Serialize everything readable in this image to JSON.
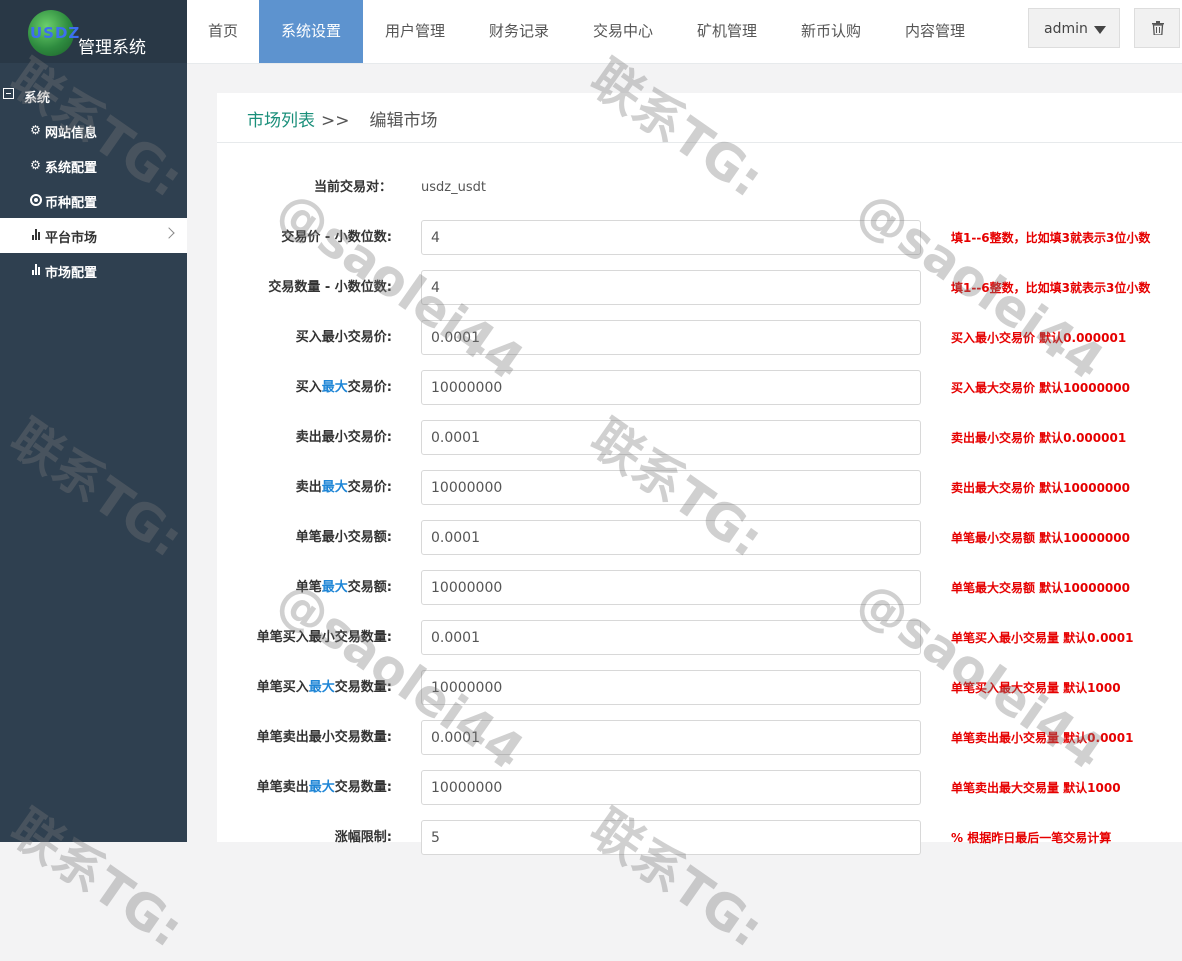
{
  "brand": {
    "logo_text": "USDZ",
    "title": "管理系统"
  },
  "sidebar": {
    "group_label": "系统",
    "items": [
      {
        "label": "网站信息",
        "icon": "gear-icon"
      },
      {
        "label": "系统配置",
        "icon": "gear-icon"
      },
      {
        "label": "币种配置",
        "icon": "target-icon"
      },
      {
        "label": "平台市场",
        "icon": "bar-chart-icon",
        "active": true
      },
      {
        "label": "市场配置",
        "icon": "bar-chart-icon"
      }
    ]
  },
  "topnav": {
    "tabs": [
      {
        "label": "首页"
      },
      {
        "label": "系统设置",
        "active": true
      },
      {
        "label": "用户管理"
      },
      {
        "label": "财务记录"
      },
      {
        "label": "交易中心"
      },
      {
        "label": "矿机管理"
      },
      {
        "label": "新币认购"
      },
      {
        "label": "内容管理"
      }
    ],
    "user": "admin"
  },
  "breadcrumb": {
    "parent": "市场列表",
    "separator": ">>",
    "current": "编辑市场"
  },
  "form": {
    "pair_label": "当前交易对：",
    "pair_value": "usdz_usdt",
    "rows": [
      {
        "label_pre": "交易价 - 小数位数:",
        "label_hl": "",
        "label_post": "",
        "value": "4",
        "hint": "填1--6整数，比如填3就表示3位小数"
      },
      {
        "label_pre": "交易数量 - 小数位数:",
        "label_hl": "",
        "label_post": "",
        "value": "4",
        "hint": "填1--6整数，比如填3就表示3位小数"
      },
      {
        "label_pre": "买入最小交易价:",
        "label_hl": "",
        "label_post": "",
        "value": "0.0001",
        "hint": "买入最小交易价 默认0.000001"
      },
      {
        "label_pre": "买入",
        "label_hl": "最大",
        "label_post": "交易价:",
        "value": "10000000",
        "hint": "买入最大交易价 默认10000000"
      },
      {
        "label_pre": "卖出最小交易价:",
        "label_hl": "",
        "label_post": "",
        "value": "0.0001",
        "hint": "卖出最小交易价 默认0.000001"
      },
      {
        "label_pre": "卖出",
        "label_hl": "最大",
        "label_post": "交易价:",
        "value": "10000000",
        "hint": "卖出最大交易价 默认10000000"
      },
      {
        "label_pre": "单笔最小交易额:",
        "label_hl": "",
        "label_post": "",
        "value": "0.0001",
        "hint": "单笔最小交易额 默认10000000"
      },
      {
        "label_pre": "单笔",
        "label_hl": "最大",
        "label_post": "交易额:",
        "value": "10000000",
        "hint": "单笔最大交易额 默认10000000"
      },
      {
        "label_pre": "单笔买入最小交易数量:",
        "label_hl": "",
        "label_post": "",
        "value": "0.0001",
        "hint": "单笔买入最小交易量 默认0.0001"
      },
      {
        "label_pre": "单笔买入",
        "label_hl": "最大",
        "label_post": "交易数量:",
        "value": "10000000",
        "hint": "单笔买入最大交易量 默认1000"
      },
      {
        "label_pre": "单笔卖出最小交易数量:",
        "label_hl": "",
        "label_post": "",
        "value": "0.0001",
        "hint": "单笔卖出最小交易量 默认0.0001"
      },
      {
        "label_pre": "单笔卖出",
        "label_hl": "最大",
        "label_post": "交易数量:",
        "value": "10000000",
        "hint": "单笔卖出最大交易量 默认1000"
      },
      {
        "label_pre": "涨幅限制:",
        "label_hl": "",
        "label_post": "",
        "value": "5",
        "hint": "% 根据昨日最后一笔交易计算"
      }
    ]
  },
  "watermark": {
    "line1": "联系TG:",
    "line2": "@saolei44"
  },
  "colors": {
    "sidebar": "#2f4050",
    "active_tab": "#5d93cf",
    "hint": "#e60000",
    "link": "#1a8f7a",
    "highlight": "#1f86d6"
  }
}
